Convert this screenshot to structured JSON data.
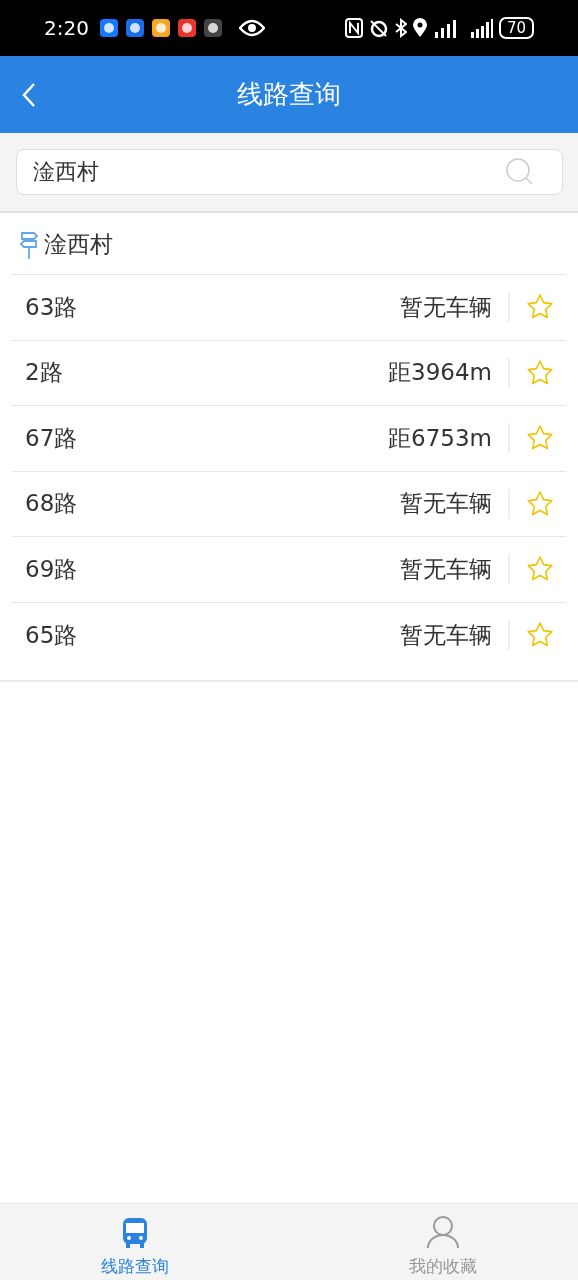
{
  "status_bar": {
    "time": "2:20",
    "battery": "70"
  },
  "header": {
    "title": "线路查询"
  },
  "search": {
    "value": "淦西村"
  },
  "stop": {
    "name": "淦西村"
  },
  "routes": [
    {
      "name": "63路",
      "status": "暂无车辆",
      "favorited": false
    },
    {
      "name": "2路",
      "status": "距3964m",
      "favorited": false
    },
    {
      "name": "67路",
      "status": "距6753m",
      "favorited": false
    },
    {
      "name": "68路",
      "status": "暂无车辆",
      "favorited": false
    },
    {
      "name": "69路",
      "status": "暂无车辆",
      "favorited": false
    },
    {
      "name": "65路",
      "status": "暂无车辆",
      "favorited": false
    }
  ],
  "bottom_nav": [
    {
      "label": "线路查询",
      "kind": "bus",
      "selected": true
    },
    {
      "label": "我的收藏",
      "kind": "person",
      "selected": false
    }
  ]
}
